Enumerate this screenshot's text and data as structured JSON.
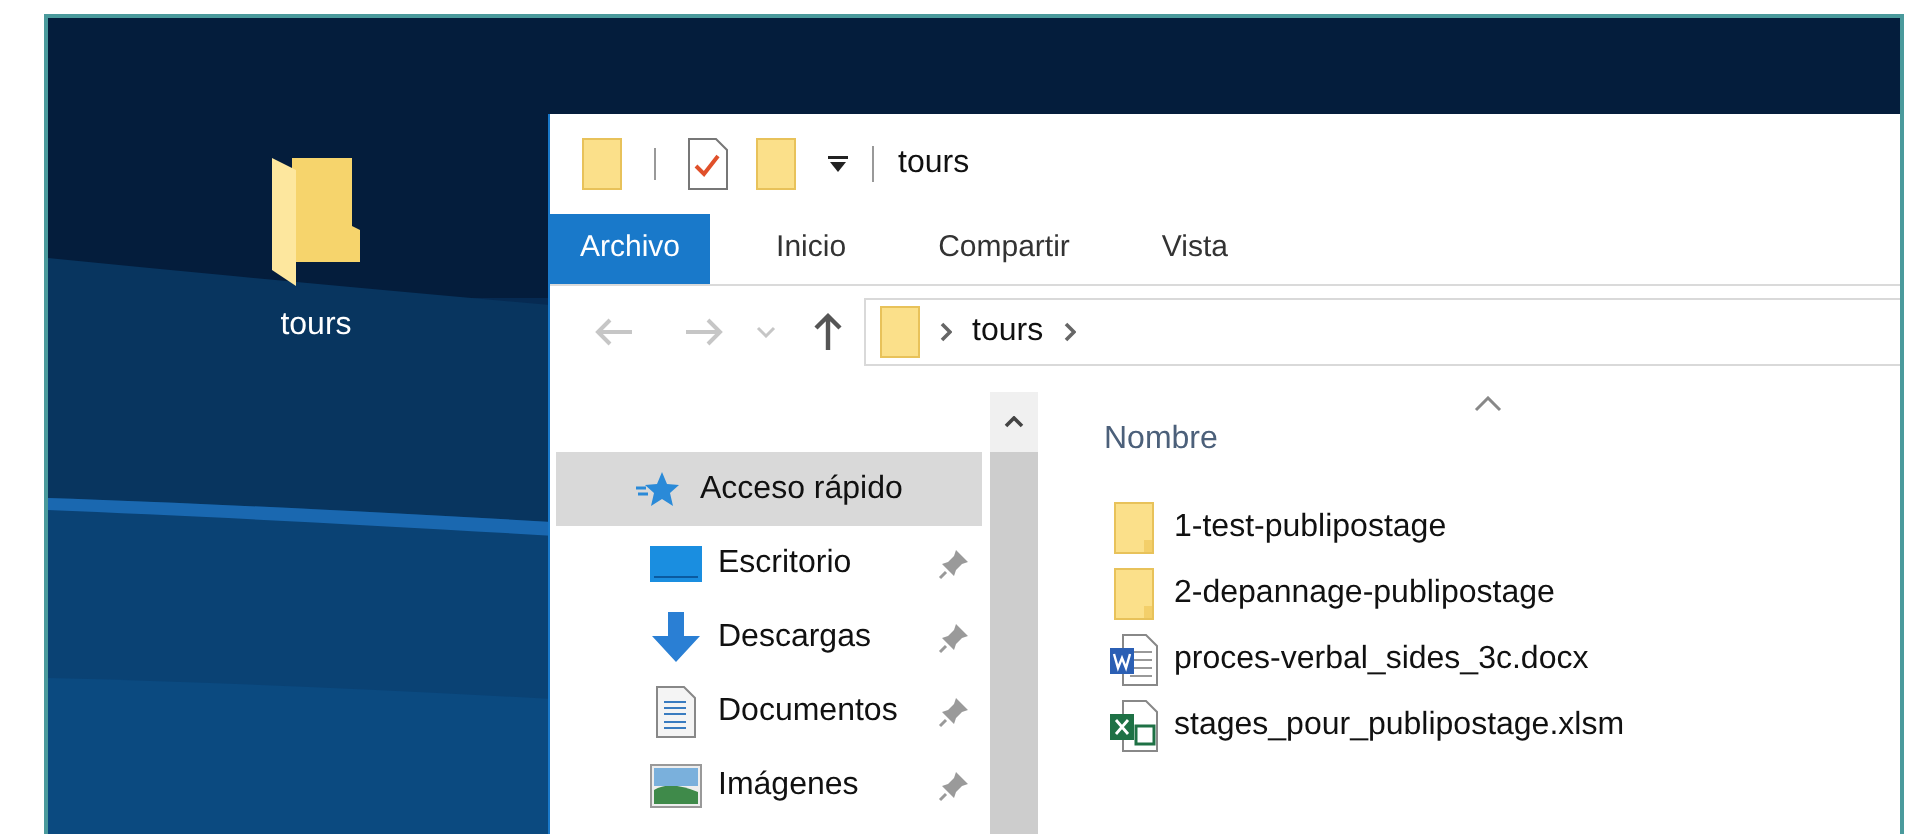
{
  "desktop": {
    "icons": [
      {
        "label": "tours",
        "kind": "folder"
      }
    ]
  },
  "window": {
    "title": "tours",
    "tabs": [
      {
        "label": "Archivo",
        "selected": true
      },
      {
        "label": "Inicio",
        "selected": false
      },
      {
        "label": "Compartir",
        "selected": false
      },
      {
        "label": "Vista",
        "selected": false
      }
    ],
    "address": {
      "path": [
        "tours"
      ]
    },
    "navigation": [
      {
        "label": "Acceso rápido",
        "kind": "star",
        "selected": true,
        "pinned": false
      },
      {
        "label": "Escritorio",
        "kind": "desktop",
        "selected": false,
        "pinned": true
      },
      {
        "label": "Descargas",
        "kind": "download",
        "selected": false,
        "pinned": true
      },
      {
        "label": "Documentos",
        "kind": "document",
        "selected": false,
        "pinned": true
      },
      {
        "label": "Imágenes",
        "kind": "pictures",
        "selected": false,
        "pinned": true
      }
    ],
    "column_header": "Nombre",
    "files": [
      {
        "name": "1-test-publipostage",
        "kind": "folder"
      },
      {
        "name": "2-depannage-publipostage",
        "kind": "folder"
      },
      {
        "name": "proces-verbal_sides_3c.docx",
        "kind": "word"
      },
      {
        "name": "stages_pour_publipostage.xlsm",
        "kind": "excel"
      }
    ]
  }
}
